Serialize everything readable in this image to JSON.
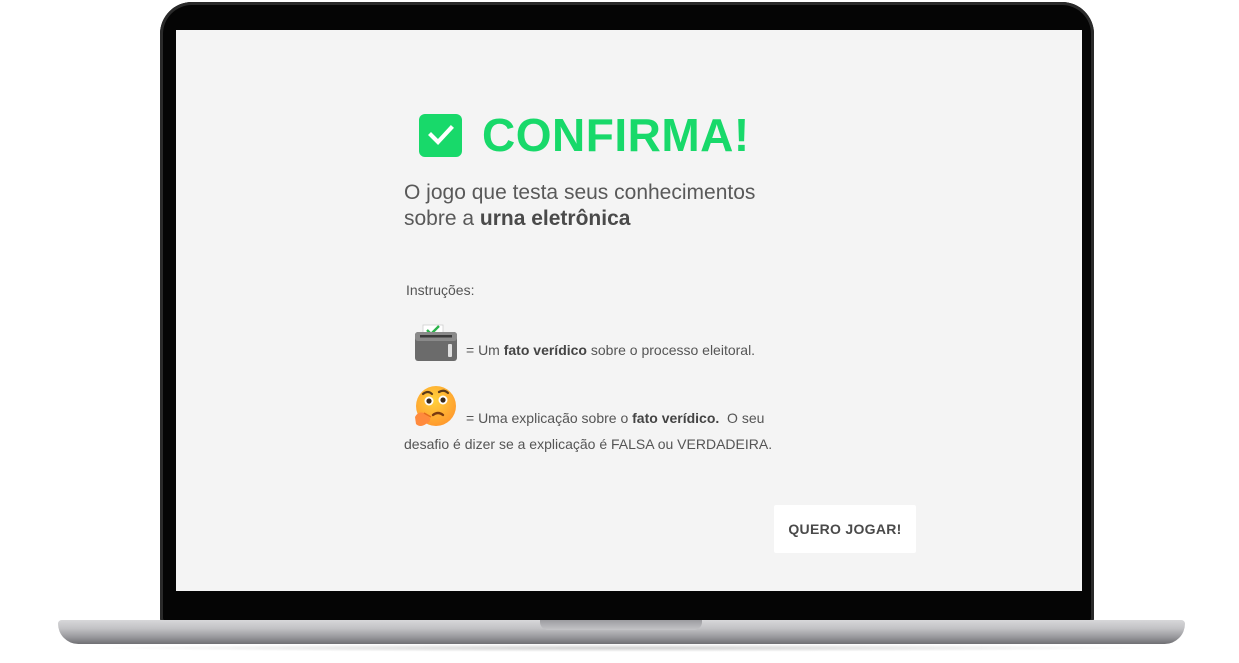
{
  "app": {
    "title": "CONFIRMA!",
    "subtitle_line1": "O jogo que testa seus conhecimentos",
    "subtitle_line2_prefix": "sobre a ",
    "subtitle_line2_bold": "urna eletrônica"
  },
  "instructions": {
    "label": "Instruções:",
    "item1": {
      "icon": "ballot-box-icon",
      "prefix": "= Um ",
      "bold": "fato verídico",
      "suffix": " sobre o processo eleitoral."
    },
    "item2": {
      "icon": "thinking-face-icon",
      "prefix": "= Uma explicação sobre o ",
      "bold": "fato verídico.",
      "suffix": "  O seu",
      "line2": "desafio é dizer se a explicação é FALSA ou VERDADEIRA."
    }
  },
  "actions": {
    "play_label": "QUERO JOGAR!"
  },
  "colors": {
    "brand_green": "#18d96a",
    "screen_bg": "#f4f4f4",
    "text": "#555555"
  }
}
